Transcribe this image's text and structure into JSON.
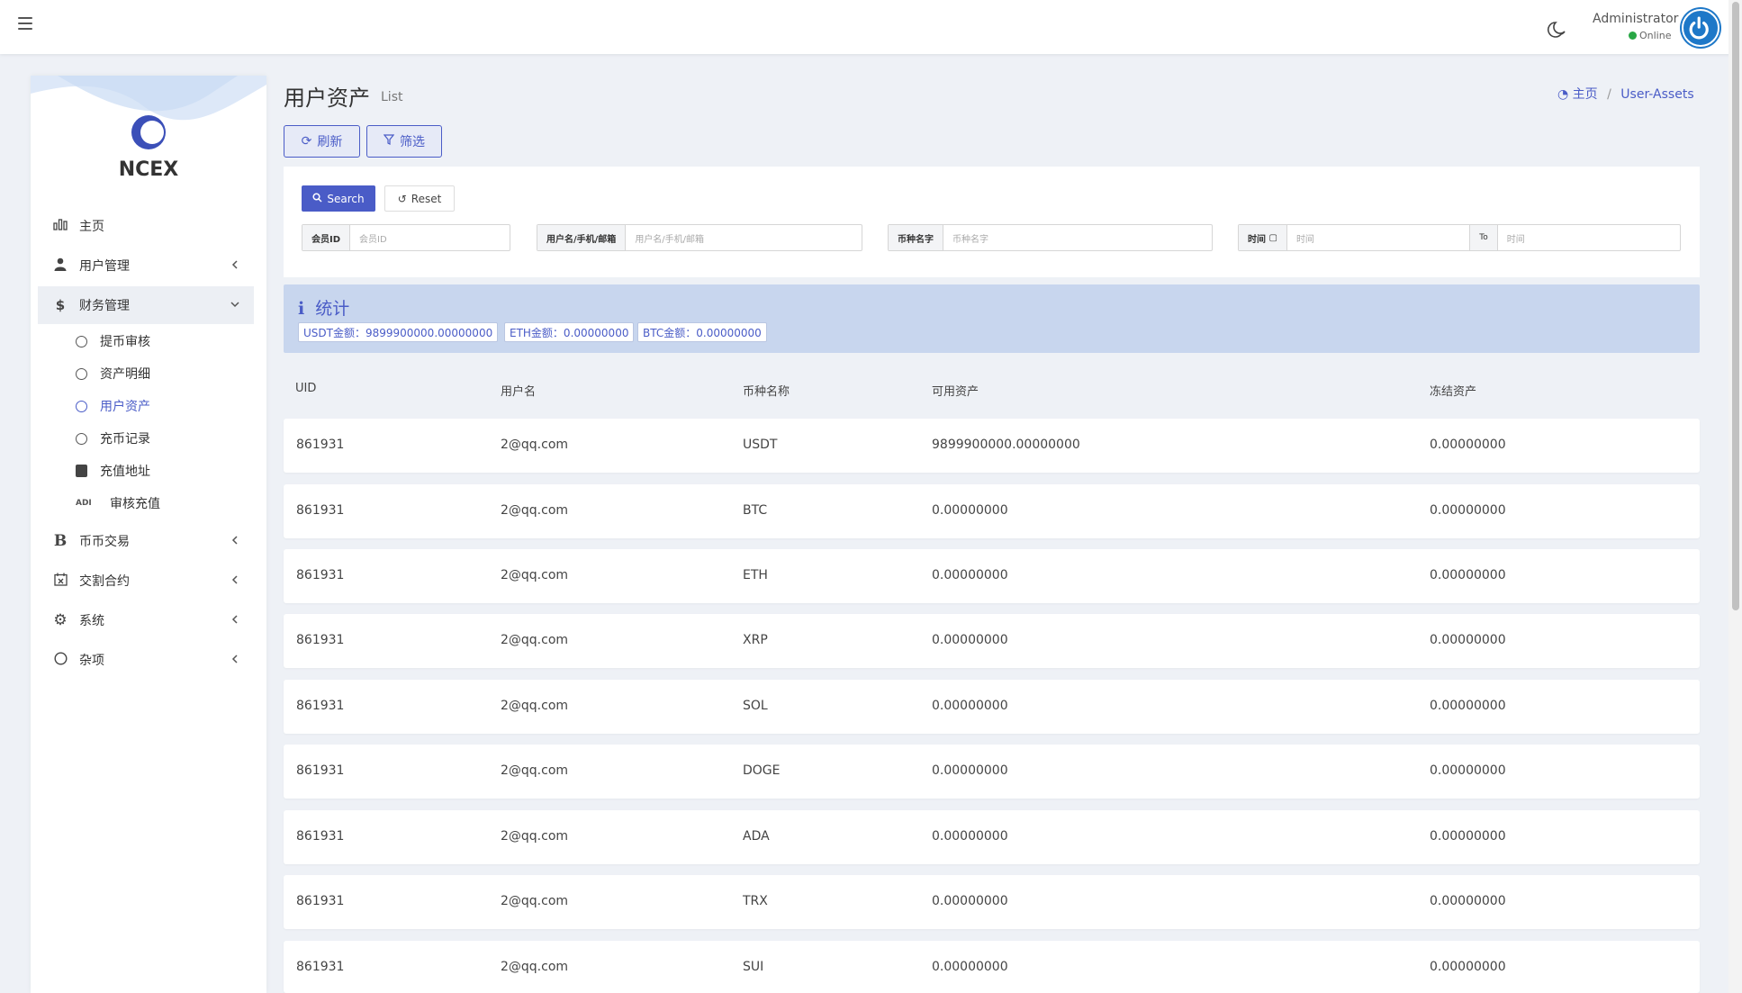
{
  "topbar": {
    "user_name": "Administrator",
    "user_status": "Online"
  },
  "sidebar": {
    "brand": "NCEX",
    "items": [
      {
        "label": "主页",
        "icon": "bar-chart-icon"
      },
      {
        "label": "用户管理",
        "icon": "user-tie-icon"
      },
      {
        "label": "财务管理",
        "icon": "dollar-icon"
      },
      {
        "label": "币币交易",
        "icon": "bitcoin-icon"
      },
      {
        "label": "交割合约",
        "icon": "calendar-x-icon"
      },
      {
        "label": "系统",
        "icon": "gear-icon"
      },
      {
        "label": "杂项",
        "icon": "circle-icon"
      }
    ],
    "finance_sub": [
      {
        "label": "提币审核"
      },
      {
        "label": "资产明细"
      },
      {
        "label": "用户资产"
      },
      {
        "label": "充币记录"
      },
      {
        "label": "充值地址"
      },
      {
        "label": "审核充值",
        "badge": "ADI"
      }
    ]
  },
  "page": {
    "title": "用户资产",
    "subtitle": "List",
    "breadcrumb_home": "主页",
    "breadcrumb_current": "User-Assets"
  },
  "toolbar": {
    "refresh_label": "刷新",
    "filter_label": "筛选"
  },
  "filter": {
    "search_label": "Search",
    "reset_label": "Reset",
    "member_id_label": "会员ID",
    "member_id_placeholder": "会员ID",
    "username_label": "用户名/手机/邮箱",
    "username_placeholder": "用户名/手机/邮箱",
    "coin_label": "币种名字",
    "coin_placeholder": "币种名字",
    "time_label": "时间",
    "time_from_placeholder": "时间",
    "time_to_label": "To",
    "time_to_placeholder": "时间"
  },
  "stats": {
    "title": "统计",
    "usdt": "USDT金额：9899900000.00000000",
    "eth": "ETH金额：0.00000000",
    "btc": "BTC金额：0.00000000"
  },
  "table": {
    "columns": [
      "UID",
      "用户名",
      "币种名称",
      "可用资产",
      "冻结资产"
    ],
    "rows": [
      {
        "uid": "861931",
        "user": "2@qq.com",
        "coin": "USDT",
        "available": "9899900000.00000000",
        "frozen": "0.00000000"
      },
      {
        "uid": "861931",
        "user": "2@qq.com",
        "coin": "BTC",
        "available": "0.00000000",
        "frozen": "0.00000000"
      },
      {
        "uid": "861931",
        "user": "2@qq.com",
        "coin": "ETH",
        "available": "0.00000000",
        "frozen": "0.00000000"
      },
      {
        "uid": "861931",
        "user": "2@qq.com",
        "coin": "XRP",
        "available": "0.00000000",
        "frozen": "0.00000000"
      },
      {
        "uid": "861931",
        "user": "2@qq.com",
        "coin": "SOL",
        "available": "0.00000000",
        "frozen": "0.00000000"
      },
      {
        "uid": "861931",
        "user": "2@qq.com",
        "coin": "DOGE",
        "available": "0.00000000",
        "frozen": "0.00000000"
      },
      {
        "uid": "861931",
        "user": "2@qq.com",
        "coin": "ADA",
        "available": "0.00000000",
        "frozen": "0.00000000"
      },
      {
        "uid": "861931",
        "user": "2@qq.com",
        "coin": "TRX",
        "available": "0.00000000",
        "frozen": "0.00000000"
      },
      {
        "uid": "861931",
        "user": "2@qq.com",
        "coin": "SUI",
        "available": "0.00000000",
        "frozen": "0.00000000"
      }
    ]
  }
}
